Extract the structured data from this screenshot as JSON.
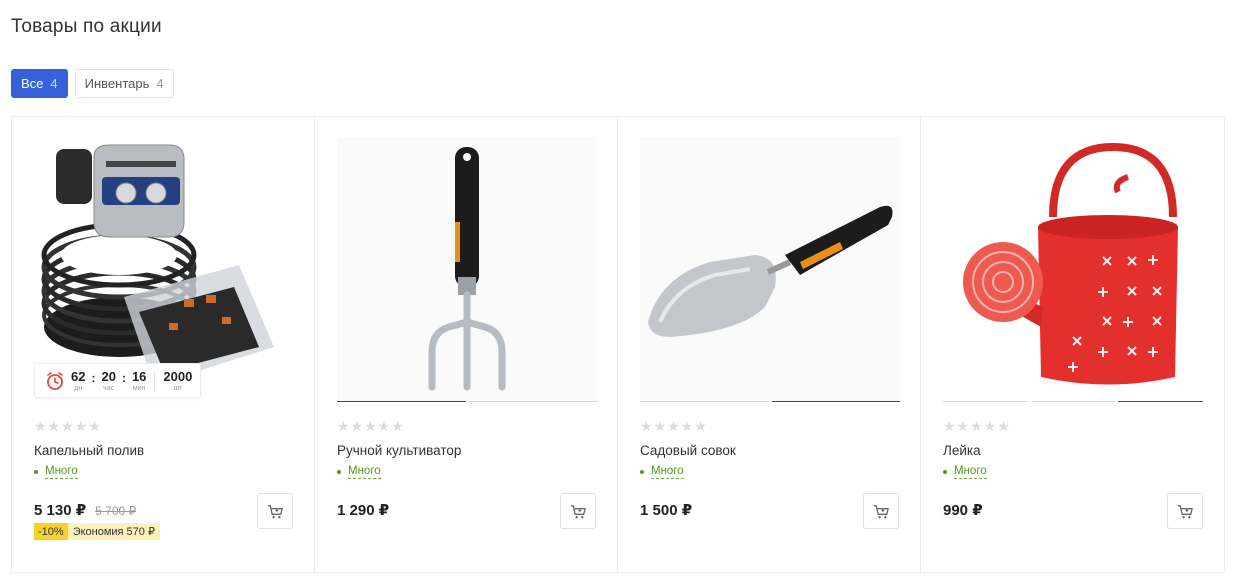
{
  "page": {
    "title": "Товары по акции"
  },
  "filters": [
    {
      "label": "Все",
      "count": "4",
      "active": true
    },
    {
      "label": "Инвентарь",
      "count": "4",
      "active": false
    }
  ],
  "products": [
    {
      "name": "Капельный полив",
      "stars": "★★★★★",
      "stock": "Много",
      "price": "5 130 ₽",
      "old_price": "5 700 ₽",
      "discount_pct": "-10%",
      "discount_save": "Экономия 570 ₽",
      "image_icon": "drip-irrigation-kit",
      "timer": {
        "days": "62",
        "days_label": "дн",
        "hours": "20",
        "hours_label": "час",
        "minutes": "16",
        "minutes_label": "мин",
        "qty": "2000",
        "qty_label": "шт"
      }
    },
    {
      "name": "Ручной культиватор",
      "stars": "★★★★★",
      "stock": "Много",
      "price": "1 290 ₽",
      "image_icon": "hand-cultivator",
      "slides": 2,
      "active_slide": 1
    },
    {
      "name": "Садовый совок",
      "stars": "★★★★★",
      "stock": "Много",
      "price": "1 500 ₽",
      "image_icon": "garden-trowel",
      "slides": 2,
      "active_slide": 2
    },
    {
      "name": "Лейка",
      "stars": "★★★★★",
      "stock": "Много",
      "price": "990 ₽",
      "image_icon": "watering-can",
      "slides": 3,
      "active_slide": 3
    }
  ],
  "colors": {
    "accent": "#3561d9",
    "stock_green": "#4e9a1c",
    "discount_yellow": "#f6d22a",
    "watering_can_red": "#e4302c"
  }
}
